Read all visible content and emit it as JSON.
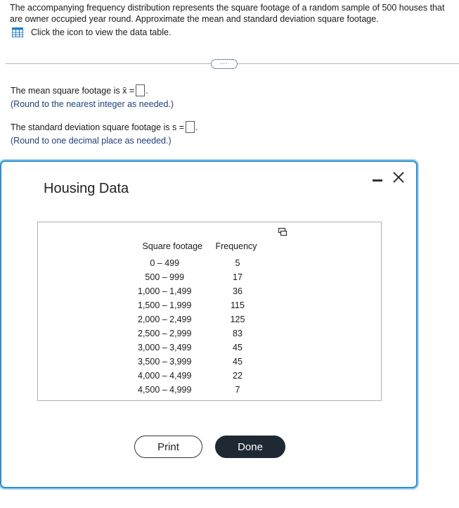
{
  "question": {
    "text": "The accompanying frequency distribution represents the square footage of a random sample of 500 houses that are owner occupied year round. Approximate the mean and standard deviation square footage.",
    "data_link_label": "Click the icon to view the data table."
  },
  "expand_label": "···",
  "mean": {
    "prompt": "The mean square footage is x̄ =",
    "value": "",
    "hint": "(Round to the nearest integer as needed.)"
  },
  "stdev": {
    "prompt": "The standard deviation square footage is s =",
    "value": "",
    "hint": "(Round to one decimal place as needed.)"
  },
  "modal": {
    "title": "Housing Data",
    "headers": {
      "range": "Square footage",
      "frequency": "Frequency"
    },
    "rows": [
      {
        "range": "0 – 499",
        "frequency": "5"
      },
      {
        "range": "500 – 999",
        "frequency": "17"
      },
      {
        "range": "1,000 – 1,499",
        "frequency": "36"
      },
      {
        "range": "1,500 – 1,999",
        "frequency": "115"
      },
      {
        "range": "2,000 – 2,499",
        "frequency": "125"
      },
      {
        "range": "2,500 – 2,999",
        "frequency": "83"
      },
      {
        "range": "3,000 – 3,499",
        "frequency": "45"
      },
      {
        "range": "3,500 – 3,999",
        "frequency": "45"
      },
      {
        "range": "4,000 – 4,499",
        "frequency": "22"
      },
      {
        "range": "4,500 – 4,999",
        "frequency": "7"
      }
    ],
    "print_label": "Print",
    "done_label": "Done"
  },
  "icons": {
    "data_table": "table-icon",
    "copy": "copy-icon",
    "minimize": "minimize-icon",
    "close": "close-icon"
  },
  "colors": {
    "hint_text": "#21407d",
    "modal_border": "#2d8fd1",
    "done_button": "#1f2933",
    "table_icon": "#2a7fc4"
  }
}
